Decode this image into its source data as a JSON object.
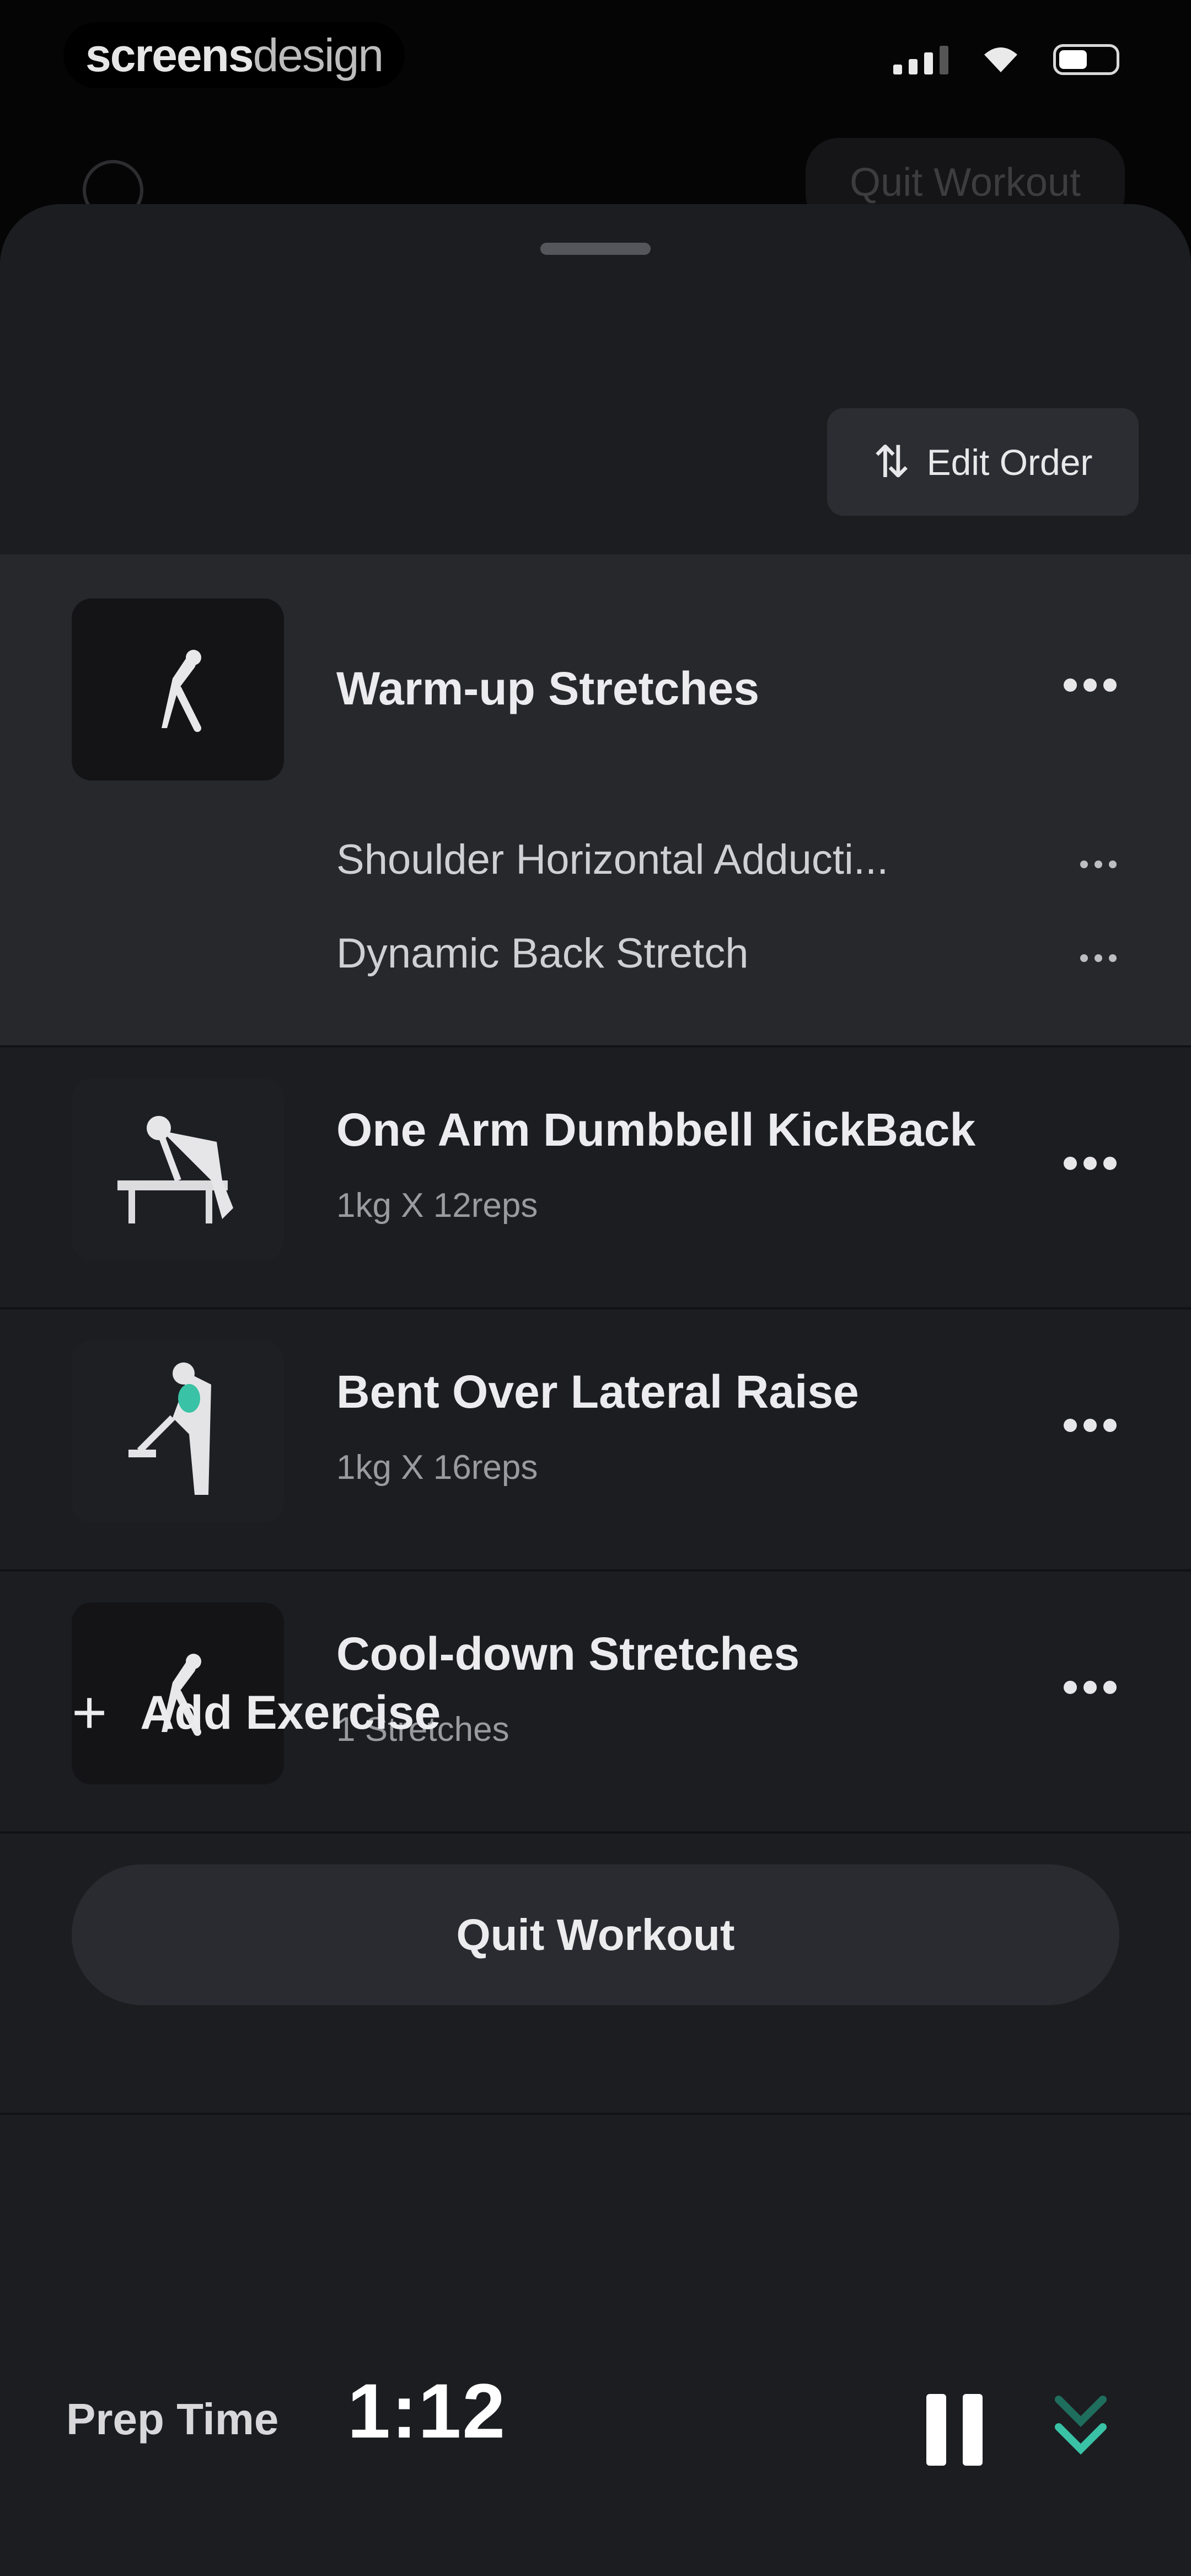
{
  "status_bar": {
    "brand_bold": "screens",
    "brand_light": "design"
  },
  "background": {
    "quit_label": "Quit Workout"
  },
  "toolbar": {
    "edit_order_label": "Edit Order"
  },
  "exercises": [
    {
      "title": "Warm-up Stretches",
      "subtitle": "",
      "items": [
        "Shoulder Horizontal Adducti...",
        "Dynamic Back Stretch"
      ]
    },
    {
      "title": "One Arm Dumbbell KickBack",
      "subtitle": "1kg X 12reps"
    },
    {
      "title": "Bent Over Lateral Raise",
      "subtitle": "1kg X 16reps"
    },
    {
      "title": "Cool-down Stretches",
      "subtitle": "1 Stretches"
    }
  ],
  "actions": {
    "add_exercise_label": "Add Exercise",
    "quit_workout_label": "Quit Workout"
  },
  "timer_bar": {
    "label": "Prep Time",
    "time": "1:12"
  },
  "colors": {
    "accent": "#39c2a5",
    "sheet_bg": "#1c1d21",
    "highlight_row": "#27282c"
  },
  "icons": {
    "edit_order": "sort-arrows-icon",
    "more": "more-horizontal-icon",
    "add": "plus-icon",
    "pause": "pause-icon",
    "collapse": "chevron-double-down-icon"
  }
}
